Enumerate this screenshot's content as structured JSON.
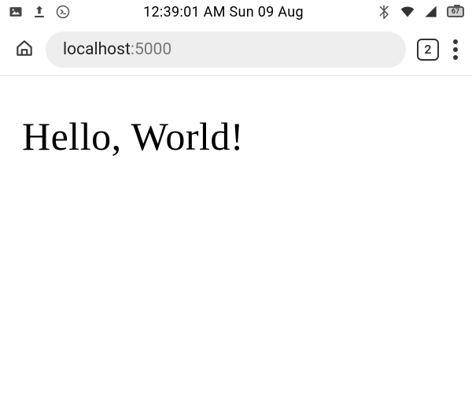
{
  "status_bar": {
    "time_date": "12:39:01 AM Sun 09 Aug",
    "battery_percent": "67",
    "icons": {
      "gallery": "gallery-icon",
      "upload": "upload-icon",
      "terminal": "terminal-icon",
      "bluetooth": "bluetooth-icon",
      "wifi": "wifi-icon",
      "cellular": "cellular-icon",
      "battery": "battery-icon"
    }
  },
  "browser": {
    "url_host": "localhost",
    "url_port": ":5000",
    "tab_count": "2",
    "icons": {
      "home": "home-icon",
      "tabs": "tabs-icon",
      "menu": "menu-icon"
    }
  },
  "page": {
    "heading": "Hello, World!"
  }
}
